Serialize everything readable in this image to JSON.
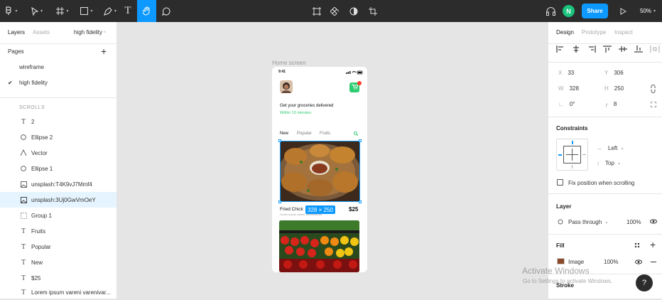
{
  "toolbar": {
    "tools": {
      "main_menu": "figma-menu-icon",
      "move": "move-arrow-icon",
      "frame": "frame-hash-icon",
      "shape": "rectangle-icon",
      "pen": "pen-icon",
      "text": "T",
      "hand": "hand-icon",
      "comment": "comment-icon"
    },
    "center_tools": [
      "component-icon",
      "diamond-icon",
      "contrast-icon",
      "crop-icon"
    ],
    "avatar_initial": "N",
    "share_label": "Share",
    "zoom_label": "50%",
    "accent": "#0d99ff"
  },
  "left_panel": {
    "tabs": [
      "Layers",
      "Assets"
    ],
    "page_selector": "high fidelity",
    "pages_title": "Pages",
    "pages": [
      {
        "label": "wireframe",
        "selected": false
      },
      {
        "label": "high fidelity",
        "selected": true
      }
    ],
    "layers_group": "SCROLLS",
    "layers": [
      {
        "icon": "text-icon",
        "label": "2"
      },
      {
        "icon": "ellipse-icon",
        "label": "Ellipse 2"
      },
      {
        "icon": "vector-icon",
        "label": "Vector"
      },
      {
        "icon": "ellipse-icon",
        "label": "Ellipse 1"
      },
      {
        "icon": "image-icon",
        "label": "unsplash:T4K9vJ7Mmf4"
      },
      {
        "icon": "image-icon",
        "label": "unsplash:3Uj0GwVmOeY",
        "selected": true
      },
      {
        "icon": "group-icon",
        "label": "Group 1"
      },
      {
        "icon": "text-icon",
        "label": "Fruits"
      },
      {
        "icon": "text-icon",
        "label": "Popular"
      },
      {
        "icon": "text-icon",
        "label": "New"
      },
      {
        "icon": "text-icon",
        "label": "$25"
      },
      {
        "icon": "text-icon",
        "label": "Lorem ipsum vareni varenivar..."
      }
    ]
  },
  "canvas": {
    "frame_label": "Home screen",
    "phone": {
      "time": "9:41",
      "headline": "Get your groceries delivered",
      "subline": "Within 10 minutes.",
      "cart_badge_color": "#ff3b30",
      "accent_green": "#2ecc71",
      "tabs": [
        "New",
        "Popular",
        "Fruits"
      ],
      "selection_size": "328 × 250",
      "item_name": "Fried Chick",
      "item_desc": "Lorem ipsum vareni varenivarenu",
      "item_price": "$25"
    }
  },
  "right_panel": {
    "tabs": [
      "Design",
      "Prototype",
      "Inspect"
    ],
    "x": {
      "label": "X",
      "value": "33"
    },
    "y": {
      "label": "Y",
      "value": "306"
    },
    "w": {
      "label": "W",
      "value": "328"
    },
    "h": {
      "label": "H",
      "value": "250"
    },
    "rotation": "0°",
    "radius": "8",
    "constraints_title": "Constraints",
    "constraint_h": "Left",
    "constraint_v": "Top",
    "fix_position_label": "Fix position when scrolling",
    "layer_title": "Layer",
    "blend_mode": "Pass through",
    "layer_opacity": "100%",
    "fill_title": "Fill",
    "fill_type": "Image",
    "fill_opacity": "100%",
    "stroke_title": "Stroke"
  },
  "watermark": {
    "title": "Activate Windows",
    "subtitle": "Go to Settings to activate Windows."
  },
  "help_label": "?"
}
